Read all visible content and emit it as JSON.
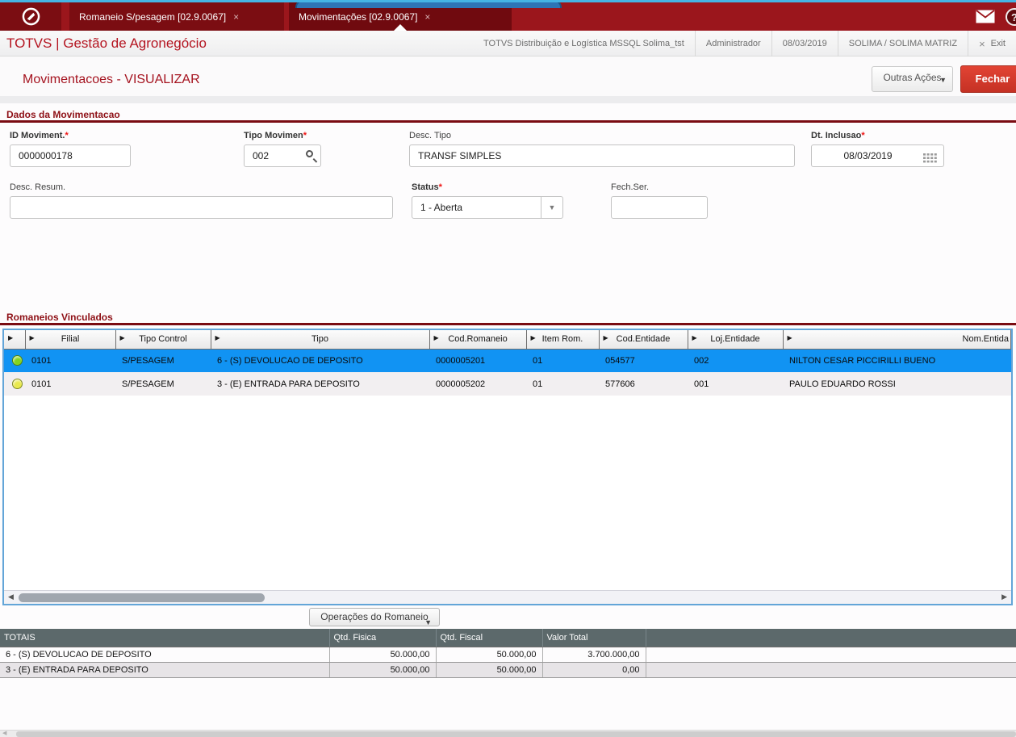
{
  "tabbar": {
    "tabs": [
      {
        "label": "Romaneio S/pesagem [02.9.0067]",
        "close": "×",
        "active": false
      },
      {
        "label": "Movimentações [02.9.0067]",
        "close": "×",
        "active": true
      }
    ],
    "help_glyph": "?"
  },
  "header": {
    "brand": "TOTVS | Gestão de Agronegócio",
    "environment": "TOTVS Distribuição e Logística MSSQL Solima_tst",
    "user": "Administrador",
    "date": "08/03/2019",
    "company": "SOLIMA / SOLIMA MATRIZ",
    "exit_glyph": "×",
    "exit_label": "Exit"
  },
  "page": {
    "title": "Movimentacoes - VISUALIZAR",
    "other_actions_label": "Outras Ações",
    "close_label": "Fechar"
  },
  "form": {
    "section_title": "Dados da Movimentacao",
    "id_moviment": {
      "label": "ID Moviment.",
      "required": "*",
      "value": "0000000178"
    },
    "tipo_movimen": {
      "label": "Tipo Movimen",
      "required": "*",
      "value": "002"
    },
    "desc_tipo": {
      "label": "Desc. Tipo",
      "value": "TRANSF SIMPLES"
    },
    "dt_inclusao": {
      "label": "Dt. Inclusao",
      "required": "*",
      "value": "08/03/2019"
    },
    "desc_resum": {
      "label": "Desc. Resum.",
      "value": ""
    },
    "status": {
      "label": "Status",
      "required": "*",
      "value": "1 - Aberta"
    },
    "fech_ser": {
      "label": "Fech.Ser.",
      "value": ""
    }
  },
  "grid": {
    "section_title": "Romaneios Vinculados",
    "columns": [
      "",
      "Filial",
      "Tipo Control",
      "Tipo",
      "Cod.Romaneio",
      "Item Rom.",
      "Cod.Entidade",
      "Loj.Entidade",
      "Nom.Entida"
    ],
    "rows": [
      {
        "status_color": "#84d41f",
        "filial": "0101",
        "tipo_control": "S/PESAGEM",
        "tipo": "6 - (S) DEVOLUCAO DE DEPOSITO",
        "cod_romaneio": "0000005201",
        "item_rom": "01",
        "cod_entidade": "054577",
        "loj_entidade": "002",
        "nom_entidade": "NILTON CESAR PICCIRILLI BUENO",
        "selected": true
      },
      {
        "status_color": "#e9e94d",
        "filial": "0101",
        "tipo_control": "S/PESAGEM",
        "tipo": "3 - (E) ENTRADA PARA DEPOSITO",
        "cod_romaneio": "0000005202",
        "item_rom": "01",
        "cod_entidade": "577606",
        "loj_entidade": "001",
        "nom_entidade": "PAULO EDUARDO ROSSI",
        "selected": false
      }
    ],
    "operations_label": "Operações do Romaneio"
  },
  "totals": {
    "columns": [
      "TOTAIS",
      "Qtd. Fisica",
      "Qtd. Fiscal",
      "Valor Total"
    ],
    "rows": [
      {
        "label": "6 - (S) DEVOLUCAO DE DEPOSITO",
        "qtd_fisica": "50.000,00",
        "qtd_fiscal": "50.000,00",
        "valor_total": "3.700.000,00"
      },
      {
        "label": "3 - (E) ENTRADA PARA DEPOSITO",
        "qtd_fisica": "50.000,00",
        "qtd_fiscal": "50.000,00",
        "valor_total": "0,00"
      }
    ]
  },
  "colors": {
    "topbar": "#9b161c",
    "tab": "#7b0d12",
    "tab_active": "#700a0f",
    "brand_red": "#b41420",
    "section_red": "#8e1016",
    "rule_red": "#7a0c12",
    "close_button_red": "#c53124",
    "grid_border_blue": "#63a5d8",
    "selected_row_blue": "#1193f3",
    "alt_row": "#f2eff1",
    "status_green": "#84d41f",
    "status_yellow": "#e9e94d",
    "totals_header_slate": "#5c696b"
  }
}
